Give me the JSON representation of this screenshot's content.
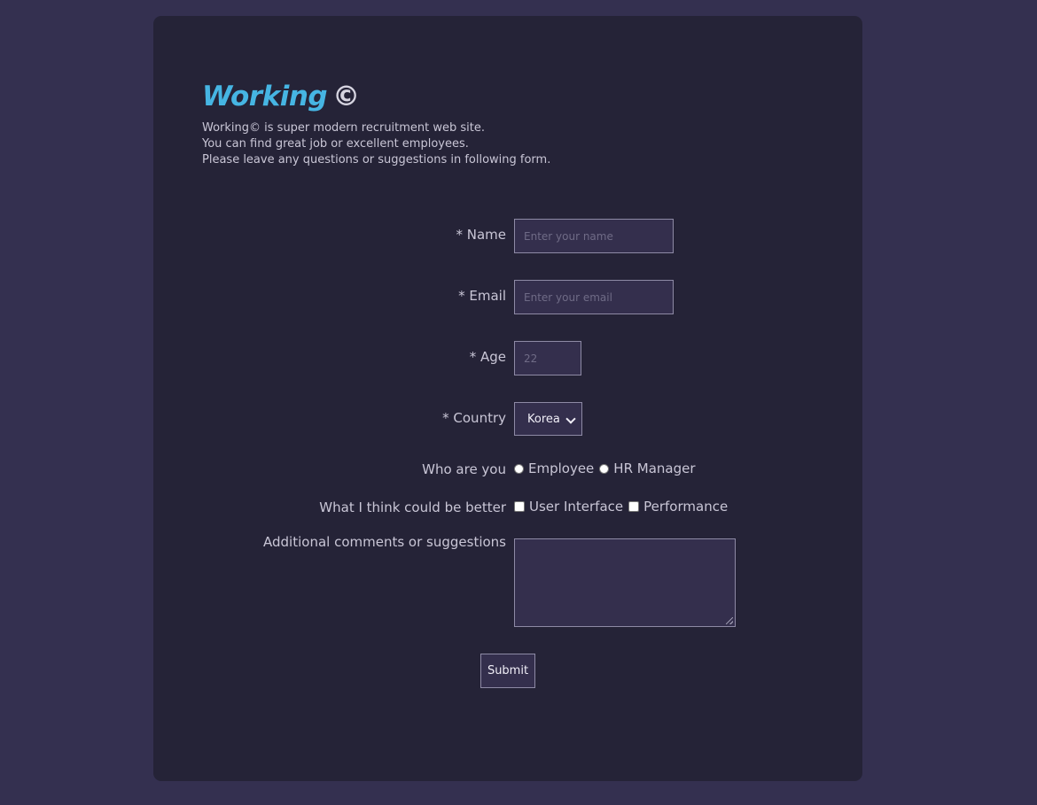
{
  "brand": {
    "name": "Working",
    "mark": "©"
  },
  "intro": {
    "lines": [
      "Working© is super modern recruitment web site.",
      "You can find great job or excellent employees.",
      "Please leave any questions or suggestions in following form."
    ]
  },
  "form": {
    "name": {
      "label": "* Name",
      "value": "",
      "placeholder": "Enter your name"
    },
    "email": {
      "label": "* Email",
      "value": "",
      "placeholder": "Enter your email"
    },
    "age": {
      "label": "* Age",
      "value": "",
      "placeholder": "22"
    },
    "country": {
      "label": "* Country",
      "selected": "Korea"
    },
    "who": {
      "label": "Who are you",
      "options": [
        "Employee",
        "HR Manager"
      ]
    },
    "improve": {
      "label": "What I think could be better",
      "options": [
        "User Interface",
        "Performance"
      ]
    },
    "comments": {
      "label": "Additional comments or suggestions",
      "value": ""
    },
    "submit_label": "Submit"
  },
  "colors": {
    "page_bg": "#343050",
    "card_bg": "#252337",
    "brand_accent": "#46b5e3",
    "input_bg": "#342f4d"
  }
}
